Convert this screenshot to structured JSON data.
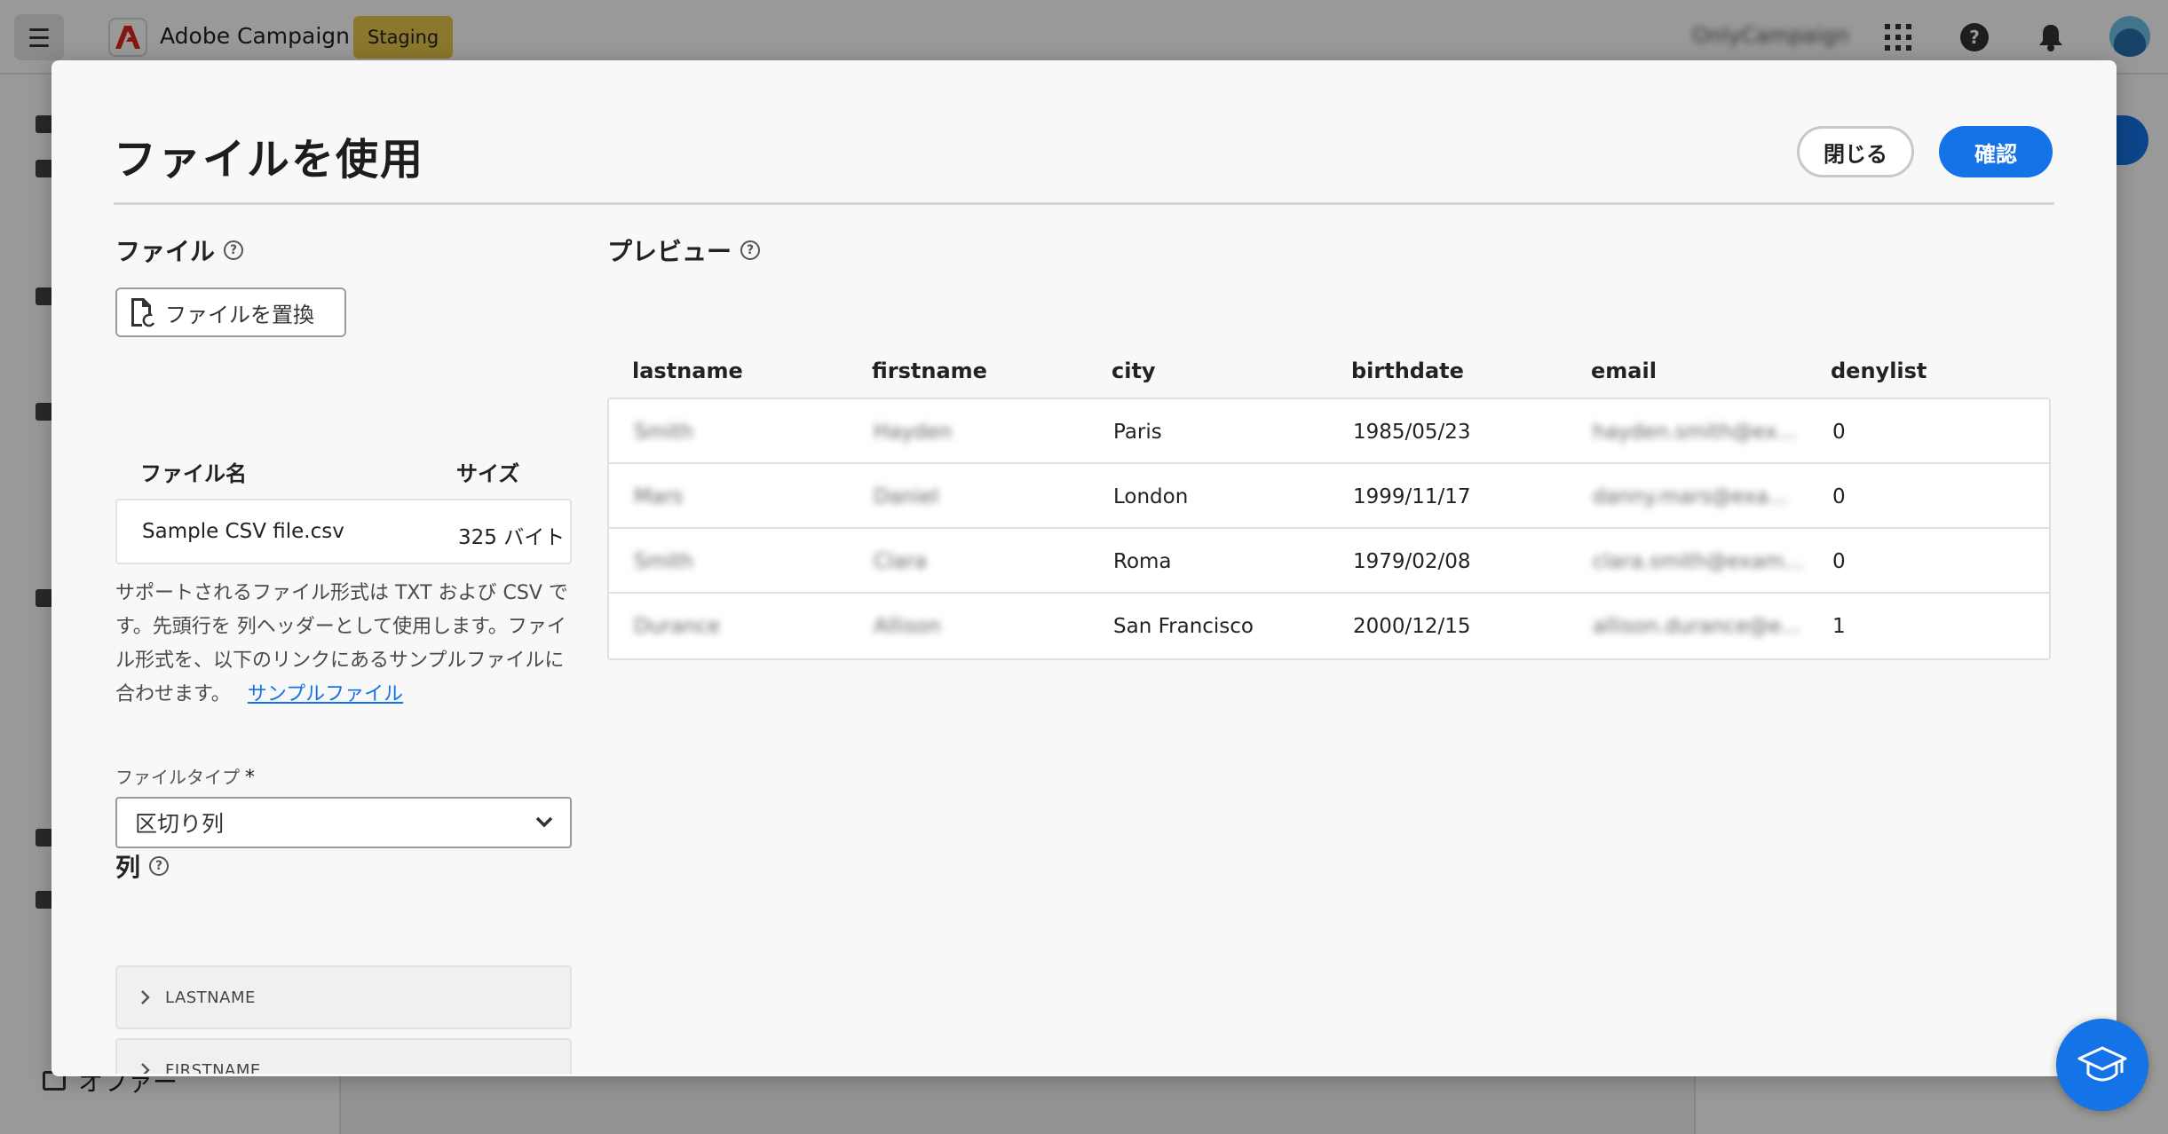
{
  "app": {
    "name": "Adobe Campaign",
    "environment": "Staging",
    "org": "OnlyCampaign",
    "icons": [
      "menu-icon",
      "adobe-logo-icon",
      "apps-grid-icon",
      "help-icon",
      "bell-icon",
      "avatar"
    ]
  },
  "sidebar": {
    "bottom_item_label": "オファー"
  },
  "modal": {
    "title": "ファイルを使用",
    "close_label": "閉じる",
    "confirm_label": "確認",
    "file_section": {
      "heading": "ファイル",
      "replace_button_label": "ファイルを置換",
      "table": {
        "headers": {
          "name": "ファイル名",
          "size": "サイズ"
        },
        "row": {
          "name": "Sample CSV file.csv",
          "size": "325 バイト"
        }
      },
      "help_text": "サポートされるファイル形式は TXT および CSV です。先頭行を 列ヘッダーとして使用します。ファイル形式を、以下のリンクにあるサンプルファイルに合わせます。",
      "sample_link_label": "サンプルファイル"
    },
    "file_type": {
      "label": "ファイルタイプ",
      "required_mark": "*",
      "selected": "区切り列"
    },
    "columns_section": {
      "heading": "列",
      "items": [
        "LASTNAME",
        "FIRSTNAME"
      ]
    },
    "preview": {
      "heading": "プレビュー",
      "columns": [
        "lastname",
        "firstname",
        "city",
        "birthdate",
        "email",
        "denylist"
      ],
      "rows": [
        [
          "Smith",
          "Hayden",
          "Paris",
          "1985/05/23",
          "hayden.smith@ex...",
          "0"
        ],
        [
          "Mars",
          "Daniel",
          "London",
          "1999/11/17",
          "danny.mars@exa...",
          "0"
        ],
        [
          "Smith",
          "Clara",
          "Roma",
          "1979/02/08",
          "clara.smith@exam...",
          "0"
        ],
        [
          "Durance",
          "Allison",
          "San Francisco",
          "2000/12/15",
          "allison.durance@e...",
          "1"
        ]
      ]
    }
  },
  "colors": {
    "accent": "#1473e6",
    "env_badge": "#e8c84a"
  }
}
